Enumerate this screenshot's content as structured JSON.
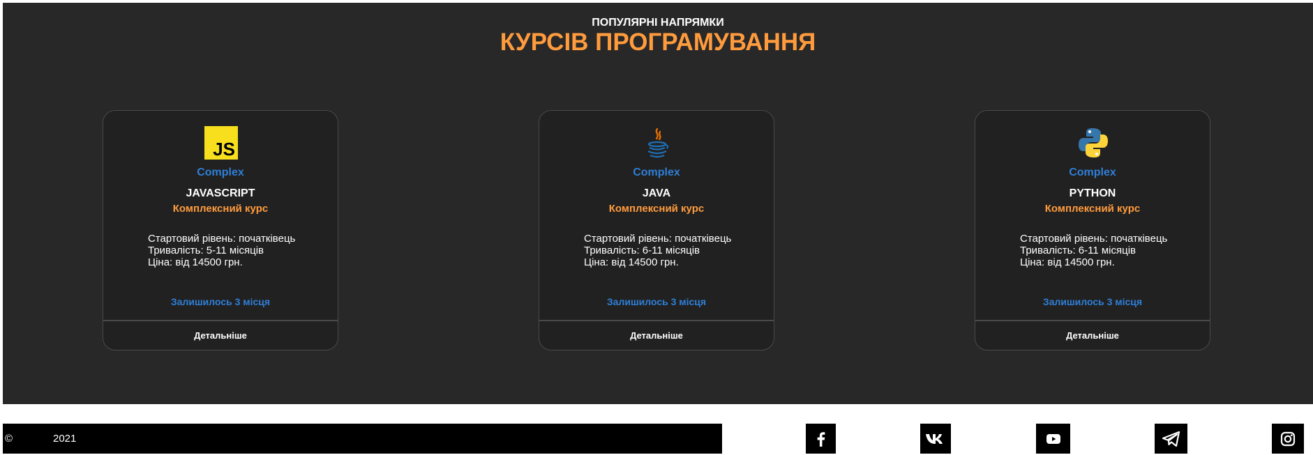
{
  "section": {
    "subtitle": "ПОПУЛЯРНІ НАПРЯМКИ",
    "title": "КУРСІВ ПРОГРАМУВАННЯ"
  },
  "courses": [
    {
      "logo": "javascript-logo-icon",
      "badge": "Complex",
      "name": "JAVASCRIPT",
      "type": "Комплексний курс",
      "level": "Стартовий рівень: початківець",
      "duration": "Тривалість: 5-11 місяців",
      "price": "Ціна: від 14500 грн.",
      "seats": "Залишилось 3 місця",
      "more": "Детальніше"
    },
    {
      "logo": "java-logo-icon",
      "badge": "Complex",
      "name": "JAVA",
      "type": "Комплексний курс",
      "level": "Стартовий рівень: початківець",
      "duration": "Тривалість: 6-11 місяців",
      "price": "Ціна: від 14500 грн.",
      "seats": "Залишилось 3 місця",
      "more": "Детальніше"
    },
    {
      "logo": "python-logo-icon",
      "badge": "Complex",
      "name": "PYTHON",
      "type": "Комплексний курс",
      "level": "Стартовий рівень: початківець",
      "duration": "Тривалість: 6-11 місяців",
      "price": "Ціна: від 14500 грн.",
      "seats": "Залишилось 3 місця",
      "more": "Детальніше"
    }
  ],
  "footer": {
    "copyright": "©",
    "year": "2021",
    "social": [
      "facebook-icon",
      "vk-icon",
      "youtube-icon",
      "telegram-icon",
      "instagram-icon"
    ]
  },
  "colors": {
    "accent_orange": "#ff9b3d",
    "accent_blue": "#2f7fd8",
    "section_bg": "#282828",
    "card_bg": "#212121"
  }
}
